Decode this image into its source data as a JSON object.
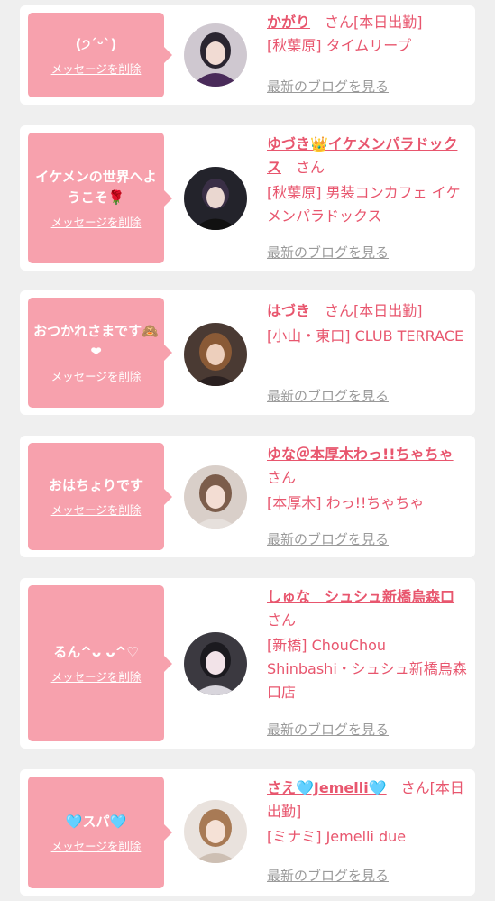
{
  "colors": {
    "accent": "#f7a1ad",
    "name": "#e8566e",
    "link_gray": "#9a9a9a"
  },
  "cards": [
    {
      "message": "(੭ˊᵕˋ)",
      "delete_label": "メッセージを削除",
      "name": "かがり",
      "suffix": "さん[本日出勤]",
      "shop": "[秋葉原] タイムリープ",
      "blog_label": "最新のブログを見る"
    },
    {
      "message": "イケメンの世界へようこそ🌹",
      "delete_label": "メッセージを削除",
      "name": "ゆづき👑イケメンパラドックス",
      "suffix": "さん",
      "shop": "[秋葉原] 男装コンカフェ イケメンパラドックス",
      "blog_label": "最新のブログを見る"
    },
    {
      "message": "おつかれさまです🙈❤",
      "delete_label": "メッセージを削除",
      "name": "はづき",
      "suffix": "さん[本日出勤]",
      "shop": "[小山・東口] CLUB TERRACE",
      "blog_label": "最新のブログを見る"
    },
    {
      "message": "おはちょりです",
      "delete_label": "メッセージを削除",
      "name": "ゆな＠本厚木わっ!!ちゃちゃ",
      "suffix": "さん",
      "shop": "[本厚木] わっ!!ちゃちゃ",
      "blog_label": "最新のブログを見る"
    },
    {
      "message": "るん^ᴗ ᴗ^♡",
      "delete_label": "メッセージを削除",
      "name": "しゅな　シュシュ新橋烏森口",
      "suffix": "さん",
      "shop": "[新橋] ChouChou Shinbashi・シュシュ新橋烏森口店",
      "blog_label": "最新のブログを見る"
    },
    {
      "message": "🩵スパ🩵",
      "delete_label": "メッセージを削除",
      "name": "さえ🩵Jemelli🩵",
      "suffix": "さん[本日出勤]",
      "shop": "[ミナミ] Jemelli due",
      "blog_label": "最新のブログを見る"
    }
  ]
}
